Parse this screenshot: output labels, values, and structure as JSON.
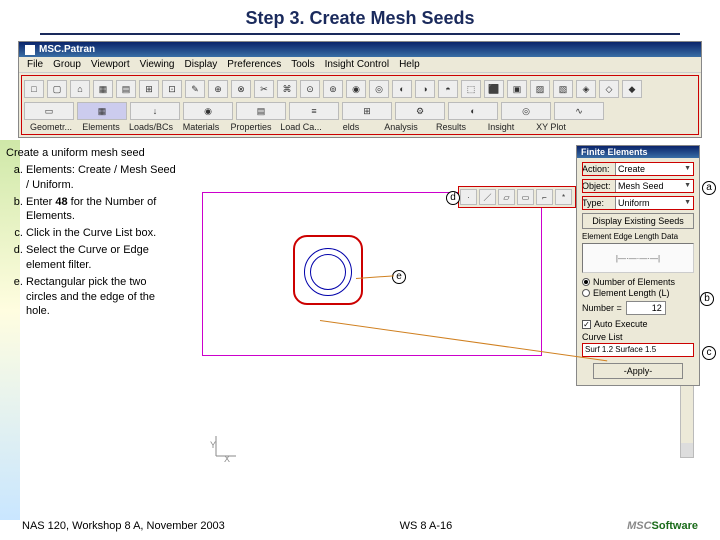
{
  "title": "Step 3. Create Mesh Seeds",
  "app": {
    "name": "MSC.Patran",
    "menu": [
      "File",
      "Group",
      "Viewport",
      "Viewing",
      "Display",
      "Preferences",
      "Tools",
      "Insight Control",
      "Help"
    ],
    "toolbar_labels": [
      "Geometr...",
      "Elements",
      "Loads/BCs",
      "Materials",
      "Properties",
      "Load Ca...",
      "elds",
      "Analysis",
      "Results",
      "Insight",
      "XY Plot"
    ]
  },
  "instructions": {
    "lead": "Create a uniform mesh seed",
    "items": [
      "Elements: Create / Mesh Seed / Uniform.",
      "Enter 48 for the Number of Elements.",
      "Click in the Curve List box.",
      "Select the Curve or Edge element filter.",
      "Rectangular pick the two circles and the edge of the hole."
    ]
  },
  "panel": {
    "title": "Finite Elements",
    "action_label": "Action:",
    "action_value": "Create",
    "object_label": "Object:",
    "object_value": "Mesh Seed",
    "type_label": "Type:",
    "type_value": "Uniform",
    "display_btn": "Display Existing Seeds",
    "seed_header": "Element Edge Length Data",
    "radio_num": "Number of Elements",
    "radio_len": "Element Length (L)",
    "number_label": "Number =",
    "number_value": "12",
    "auto_execute": "Auto Execute",
    "curve_list_label": "Curve List",
    "curve_list_value": "Surf 1.2 Surface 1.5",
    "apply": "-Apply-"
  },
  "callouts": {
    "a": "a",
    "b": "b",
    "c": "c",
    "d": "d",
    "e": "e"
  },
  "axis": {
    "x": "X",
    "y": "Y"
  },
  "footer": {
    "left": "NAS 120, Workshop 8 A, November 2003",
    "center": "WS 8 A-16",
    "logo_prefix": "MSC",
    "logo_suffix": "Software"
  }
}
